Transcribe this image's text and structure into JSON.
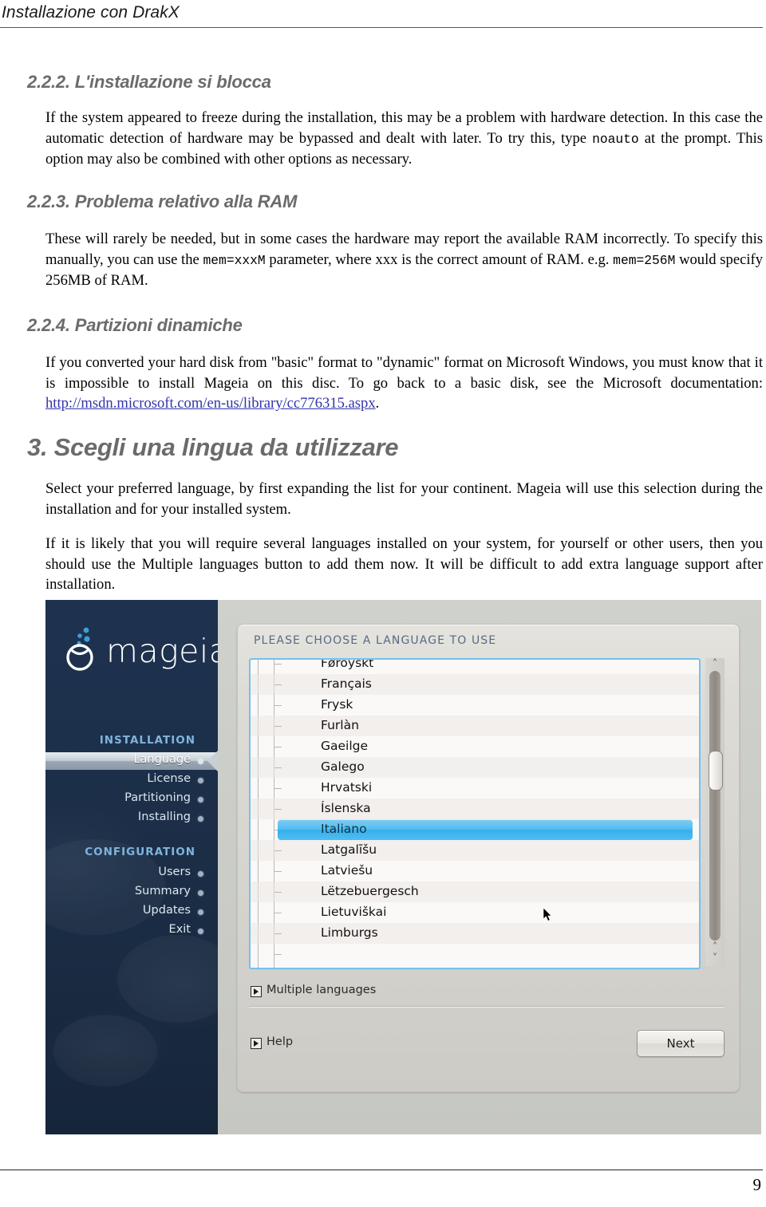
{
  "header": {
    "running_title": "Installazione con DrakX"
  },
  "footer": {
    "page_number": "9"
  },
  "sections": {
    "s222": {
      "heading": "2.2.2. L'installazione si blocca",
      "para_part1": "If the system appeared to freeze during the installation, this may be a problem with hardware detection. In this case the automatic detection of hardware may be bypassed and dealt with later. To try this, type ",
      "code1": "noauto",
      "para_part2": " at the prompt. This option may also be combined with other options as necessary."
    },
    "s223": {
      "heading": "2.2.3. Problema relativo alla RAM",
      "para_part1": "These will rarely be needed, but in some cases the hardware may report the available RAM incorrectly. To specify this manually, you can use the ",
      "code1": "mem=xxxM",
      "para_part2": " parameter, where xxx is the correct amount of RAM. e.g. ",
      "code2": "mem=256M",
      "para_part3": " would specify 256MB of RAM."
    },
    "s224": {
      "heading": "2.2.4. Partizioni dinamiche",
      "para_part1": "If you converted your hard disk from \"basic\" format to \"dynamic\" format on Microsoft Windows, you must know that it is impossible to install Mageia on this disc. To go back to a basic disk, see the Microsoft documentation: ",
      "link_text": "http://msdn.microsoft.com/en-us/library/cc776315.aspx",
      "para_part2": "."
    },
    "s3": {
      "heading": "3. Scegli una lingua da utilizzare",
      "para1": "Select your preferred language, by first expanding the list for your continent. Mageia will use this selection during the installation and for your installed system.",
      "para2": "If it is likely that you will require several languages installed on your system, for yourself or other users, then you should use the Multiple languages button to add them now. It will be difficult to add extra language support after installation."
    }
  },
  "installer": {
    "logo_text": "mageia",
    "sidebar": {
      "group_installation": "INSTALLATION",
      "group_configuration": "CONFIGURATION",
      "items_installation": [
        {
          "label": "Language",
          "active": true
        },
        {
          "label": "License",
          "active": false
        },
        {
          "label": "Partitioning",
          "active": false
        },
        {
          "label": "Installing",
          "active": false
        }
      ],
      "items_configuration": [
        {
          "label": "Users",
          "active": false
        },
        {
          "label": "Summary",
          "active": false
        },
        {
          "label": "Updates",
          "active": false
        },
        {
          "label": "Exit",
          "active": false
        }
      ]
    },
    "panel_title": "PLEASE CHOOSE A LANGUAGE TO USE",
    "language_list": [
      {
        "label": "Føroyskt",
        "selected": false
      },
      {
        "label": "Français",
        "selected": false
      },
      {
        "label": "Frysk",
        "selected": false
      },
      {
        "label": "Furlàn",
        "selected": false
      },
      {
        "label": "Gaeilge",
        "selected": false
      },
      {
        "label": "Galego",
        "selected": false
      },
      {
        "label": "Hrvatski",
        "selected": false
      },
      {
        "label": "Íslenska",
        "selected": false
      },
      {
        "label": "Italiano",
        "selected": true
      },
      {
        "label": "Latgalīšu",
        "selected": false
      },
      {
        "label": "Latviešu",
        "selected": false
      },
      {
        "label": "Lëtzebuergesch",
        "selected": false
      },
      {
        "label": "Lietuviškai",
        "selected": false
      },
      {
        "label": "Limburgs",
        "selected": false
      }
    ],
    "selected_language": "Italiano",
    "buttons": {
      "multiple_languages": "Multiple languages",
      "help": "Help",
      "next": "Next"
    },
    "scrollbar": {
      "up_arrow": "˄",
      "down_arrow": "˅"
    },
    "colors": {
      "sidebar_bg": "#1d3049",
      "accent_blue": "#7fb4dc",
      "selection_blue": "#53bdf0",
      "list_border": "#72c1ef",
      "panel_bg": "#dedcd6"
    }
  }
}
